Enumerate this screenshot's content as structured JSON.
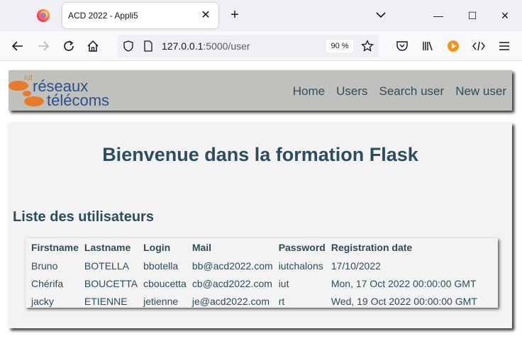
{
  "browser": {
    "tab": {
      "title": "ACD 2022 - Appli5"
    },
    "url": {
      "host": "127.0.0.1",
      "path": ":5000/user"
    },
    "zoom": "90 %"
  },
  "header": {
    "logo": {
      "line1": "iut",
      "line2": "réseaux",
      "line3": "télécoms"
    },
    "menu": [
      "Home",
      "Users",
      "Search user",
      "New user"
    ]
  },
  "main": {
    "title": "Bienvenue dans la formation Flask",
    "subtitle": "Liste des utilisateurs"
  },
  "table": {
    "columns": [
      "Firstname",
      "Lastname",
      "Login",
      "Mail",
      "Password",
      "Registration date"
    ],
    "rows": [
      [
        "Bruno",
        "BOTELLA",
        "bbotella",
        "bb@acd2022.com",
        "iutchalons",
        "17/10/2022"
      ],
      [
        "Chérifa",
        "BOUCETTA",
        "cboucetta",
        "cb@acd2022.com",
        "iut",
        "Mon, 17 Oct 2022 00:00:00 GMT"
      ],
      [
        "jacky",
        "ETIENNE",
        "jetienne",
        "je@acd2022.com",
        "rt",
        "Wed, 19 Oct 2022 00:00:00 GMT"
      ]
    ]
  },
  "colors": {
    "heading": "#2d4d5c",
    "header_bg": "#c0c1bd",
    "logo_orange": "#e87a2a",
    "logo_blue": "#2b4f8c"
  }
}
